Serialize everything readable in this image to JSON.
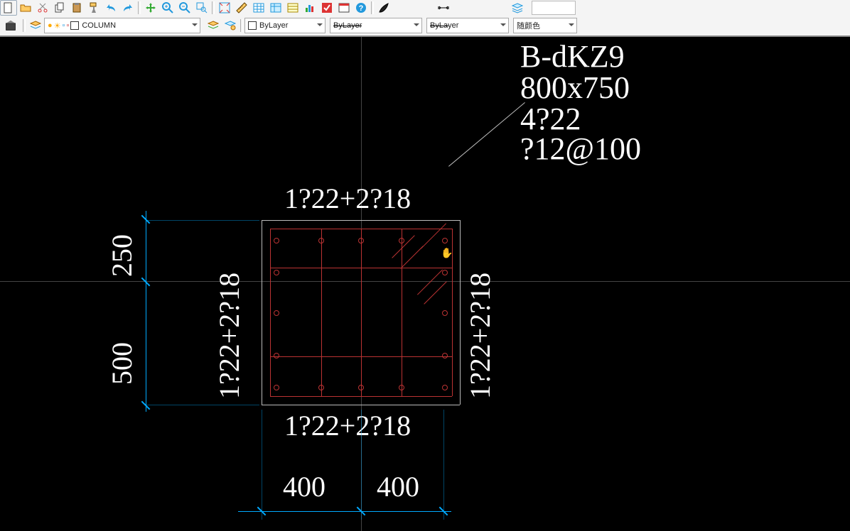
{
  "toolbar": {
    "layer_combo": "COLUMN",
    "prop_combo1": "ByLayer",
    "prop_combo2": "ByLayer",
    "prop_combo3": "ByLayer",
    "color_combo": "随颜色"
  },
  "annotations": {
    "col_id": "B-dKZ9",
    "col_size": "800x750",
    "corner_bar": "4?22",
    "stirrup": "?12@100",
    "top_rebar": "1?22+2?18",
    "bottom_rebar": "1?22+2?18",
    "left_rebar": "1?22+2?18",
    "right_rebar": "1?22+2?18",
    "dim_250": "250",
    "dim_500": "500",
    "dim_400a": "400",
    "dim_400b": "400"
  }
}
